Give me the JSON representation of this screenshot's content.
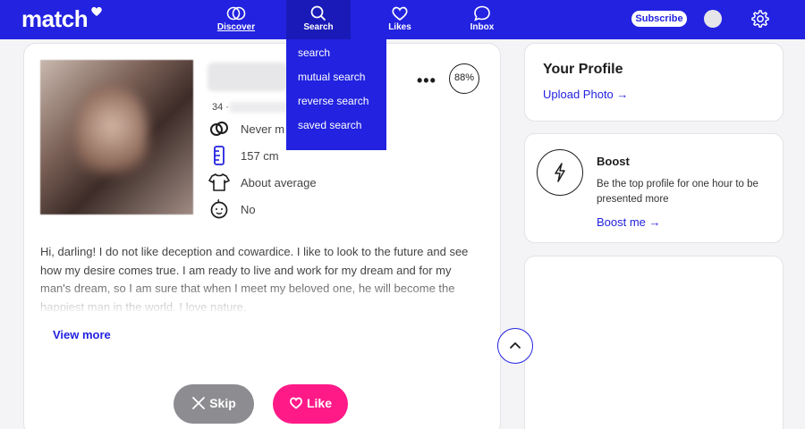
{
  "brand": {
    "logo_text": "match",
    "primary_color": "#2222e0",
    "like_color": "#ff1a88"
  },
  "nav": {
    "items": [
      {
        "label": "Discover",
        "icon": "discover-icon"
      },
      {
        "label": "Search",
        "icon": "search-icon"
      },
      {
        "label": "Likes",
        "icon": "heart-icon"
      },
      {
        "label": "Inbox",
        "icon": "chat-icon"
      }
    ],
    "subscribe_label": "Subscribe",
    "settings_icon": "gear-icon"
  },
  "search_dropdown": {
    "options": [
      "search",
      "mutual search",
      "reverse search",
      "saved search"
    ]
  },
  "profile": {
    "age": "34 ·",
    "match_percent": "88%",
    "more_label": "•••",
    "attributes": [
      {
        "icon": "rings-icon",
        "text": "Never m"
      },
      {
        "icon": "ruler-icon",
        "text": "157 cm"
      },
      {
        "icon": "shirt-icon",
        "text": "About average"
      },
      {
        "icon": "baby-icon",
        "text": "No"
      }
    ],
    "bio": "Hi, darling! I do not like deception and cowardice. I like to look to the future and see how my desire comes true. I am ready to live and work for my dream and for my man's dream, so I am sure that when I meet my beloved one, he will become the happiest man in the world. I love nature,",
    "view_more_label": "View more",
    "skip_label": "Skip",
    "like_label": "Like"
  },
  "your_profile": {
    "title": "Your Profile",
    "link_label": "Upload Photo →"
  },
  "boost": {
    "title": "Boost",
    "description": "Be the top profile for one hour to be presented more",
    "link_label": "Boost me →"
  }
}
